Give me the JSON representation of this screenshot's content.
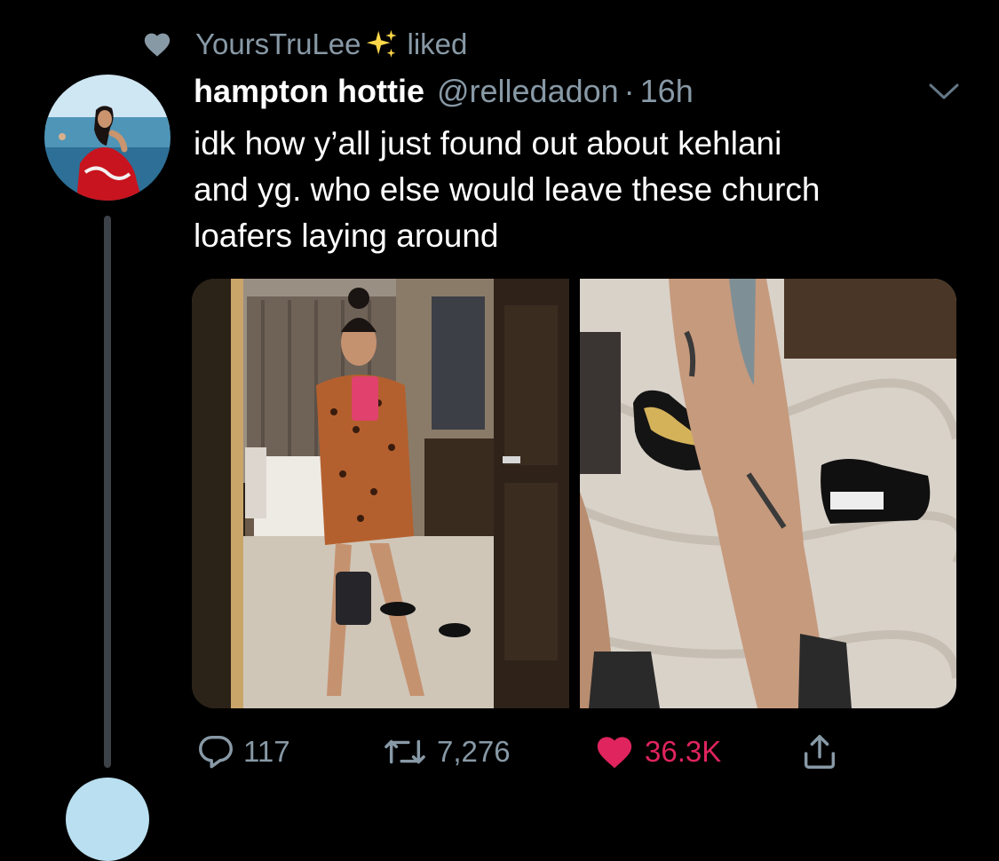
{
  "social_context": {
    "user": "YoursTruLee",
    "action": "liked"
  },
  "tweet": {
    "display_name": "hampton hottie",
    "handle": "@relledadon",
    "separator": "·",
    "time": "16h",
    "text_lines": [
      "idk how y’all just found out about kehlani",
      "and yg. who else would leave these church",
      "loafers laying around"
    ]
  },
  "actions": {
    "replies": "117",
    "retweets": "7,276",
    "likes": "36.3K"
  },
  "icons": {
    "liked_heart": "heart-icon",
    "sparkles": "sparkles-icon",
    "reply": "reply-icon",
    "retweet": "retweet-icon",
    "share": "share-icon",
    "more": "chevron-down-icon"
  },
  "colors": {
    "background": "#000000",
    "secondary_text": "#8899a6",
    "like_red": "#e0245e",
    "primary_text": "#ffffff"
  }
}
